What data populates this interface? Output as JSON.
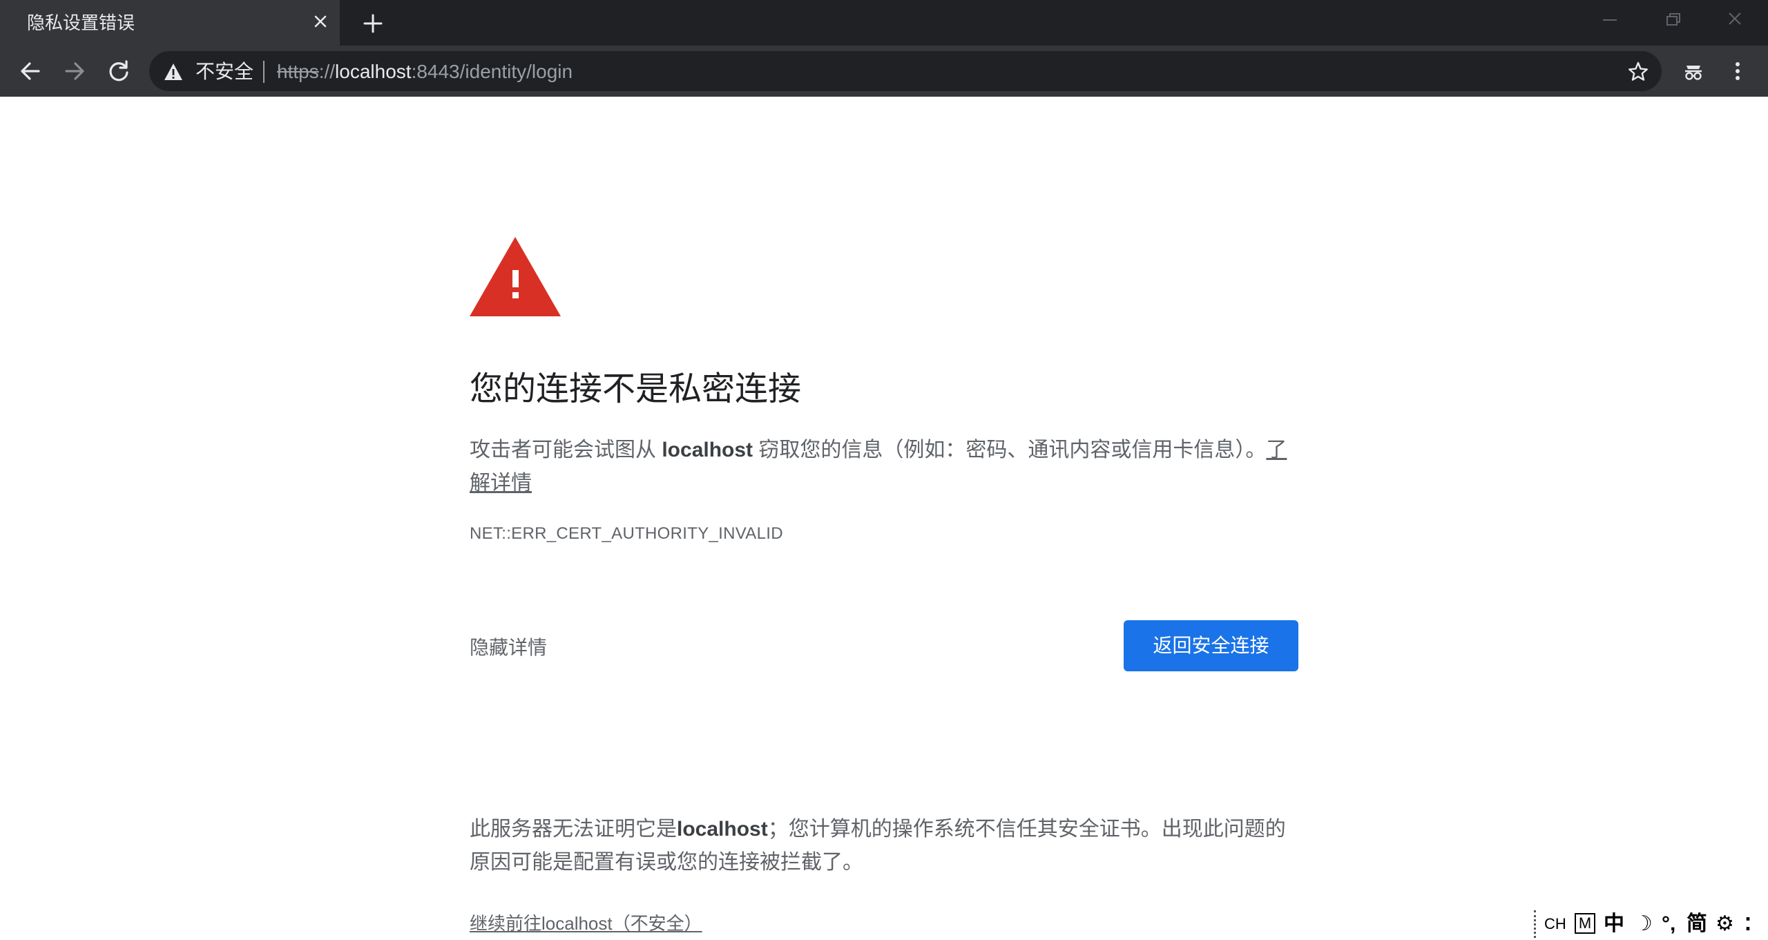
{
  "browser": {
    "tab": {
      "title": "隐私设置错误"
    },
    "omnibox": {
      "security_label": "不安全",
      "url_scheme": "https",
      "url_separator": "://",
      "url_host": "localhost",
      "url_rest": ":8443/identity/login"
    }
  },
  "interstitial": {
    "heading": "您的连接不是私密连接",
    "explanation_before": "攻击者可能会试图从 ",
    "explanation_host": "localhost",
    "explanation_after": " 窃取您的信息（例如：密码、通讯内容或信用卡信息）。",
    "learn_more": "了解详情",
    "error_code": "NET::ERR_CERT_AUTHORITY_INVALID",
    "details_button": "隐藏详情",
    "primary_button": "返回安全连接",
    "details_before": "此服务器无法证明它是",
    "details_host": "localhost",
    "details_after": "；您计算机的操作系统不信任其安全证书。出现此问题的原因可能是配置有误或您的连接被拦截了。",
    "proceed_link": "继续前往localhost（不安全）"
  },
  "ime": {
    "lang": "CH",
    "mode": "M",
    "chinese": "中",
    "moon": "☽",
    "punct": "°,",
    "simplified": "简",
    "gear": "⚙",
    "more": "⁚"
  },
  "colors": {
    "chrome_dark": "#202124",
    "toolbar": "#35363a",
    "primary_blue": "#1a73e8",
    "warning_red": "#d93025"
  },
  "icons": [
    "close-icon",
    "plus-icon",
    "minimize-icon",
    "restore-icon",
    "back-arrow-icon",
    "forward-arrow-icon",
    "reload-icon",
    "warning-triangle-icon",
    "star-icon",
    "extension-icon",
    "kebab-menu-icon"
  ]
}
